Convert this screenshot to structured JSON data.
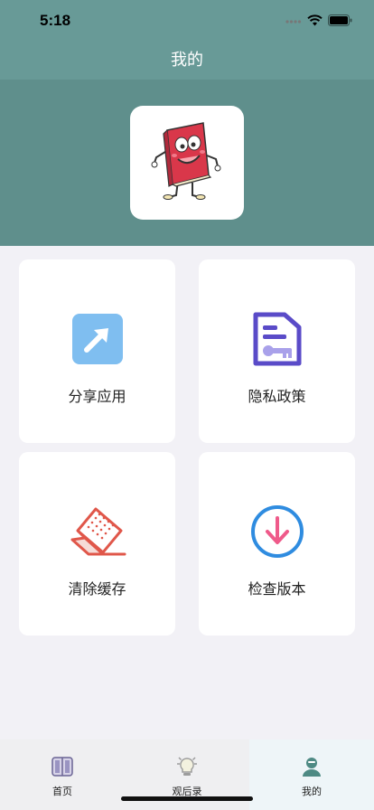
{
  "status_bar": {
    "time": "5:18"
  },
  "nav": {
    "title": "我的"
  },
  "header": {
    "avatar_icon": "book-mascot-icon"
  },
  "cards": {
    "share": {
      "label": "分享应用",
      "icon": "share-arrow-icon",
      "color": "#7fbef0"
    },
    "privacy": {
      "label": "隐私政策",
      "icon": "document-key-icon",
      "color": "#5a4bc8"
    },
    "clear": {
      "label": "清除缓存",
      "icon": "eraser-icon",
      "color": "#e0574a"
    },
    "update": {
      "label": "检查版本",
      "icon": "download-circle-icon",
      "color": "#2f8ce0"
    }
  },
  "tabbar": {
    "tabs": [
      {
        "label": "首页",
        "icon": "book-icon"
      },
      {
        "label": "观后录",
        "icon": "lightbulb-icon"
      },
      {
        "label": "我的",
        "icon": "user-icon"
      }
    ],
    "active_index": 2
  }
}
